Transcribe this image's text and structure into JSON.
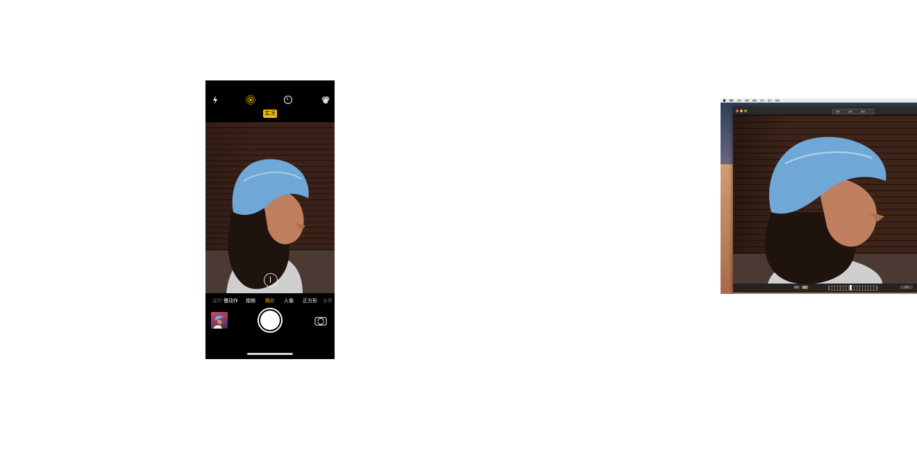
{
  "camera": {
    "live_badge": "实况",
    "modes": [
      "延时",
      "慢动作",
      "视频",
      "照片",
      "人像",
      "正方形",
      "全景"
    ],
    "selected_mode": "照片",
    "icons": {
      "flash": "flash-icon",
      "live": "live-photo-icon",
      "timer": "timer-icon",
      "filters": "filters-icon",
      "flip": "camera-flip-icon"
    },
    "accent_color": "#f7c400"
  },
  "mac": {
    "menu": [
      "照片",
      "文件",
      "编辑",
      "图像",
      "显示",
      "窗口",
      "帮助"
    ],
    "toolbar_segments": [
      "调整",
      "滤镜",
      "裁剪"
    ],
    "bottom_buttons": [
      "实况",
      "静音",
      "还原"
    ]
  }
}
